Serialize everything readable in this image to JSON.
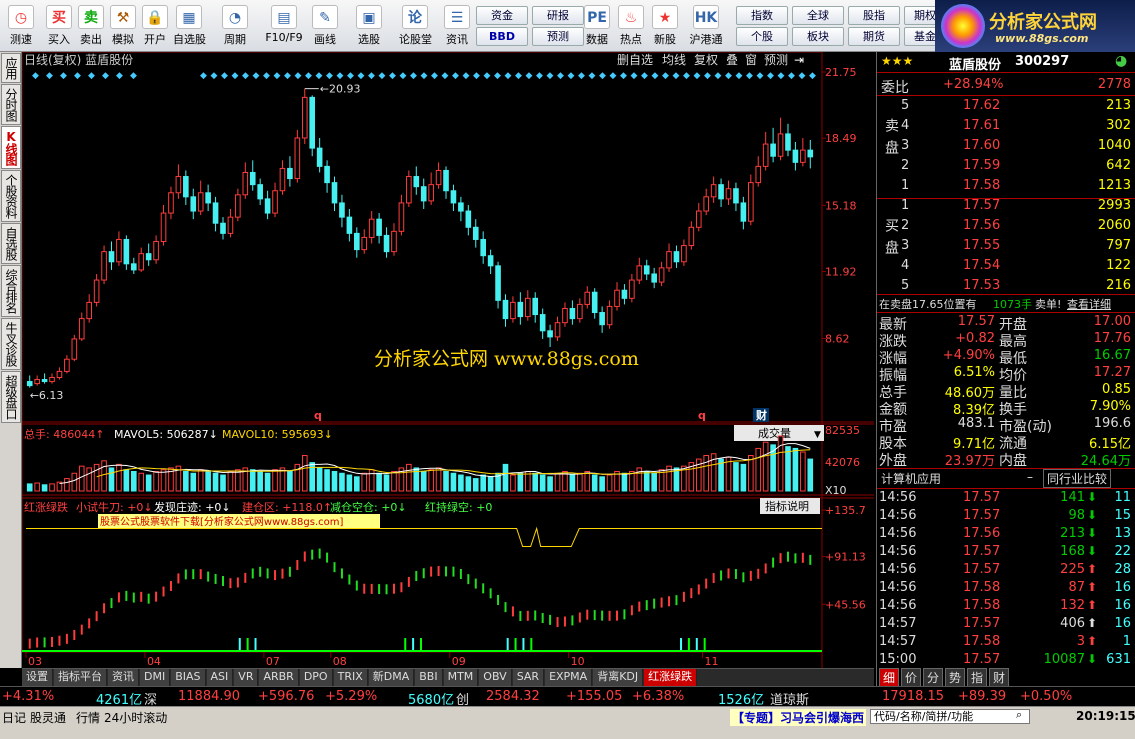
{
  "toolbar": {
    "buttons": [
      {
        "label": "测速",
        "icon": "clock-icon",
        "glyph": "◷",
        "color": "#e33"
      },
      {
        "label": "买入",
        "icon": "buy-icon",
        "glyph": "买",
        "color": "#e33"
      },
      {
        "label": "卖出",
        "icon": "sell-icon",
        "glyph": "卖",
        "color": "#1a1"
      },
      {
        "label": "模拟",
        "icon": "hammer-icon",
        "glyph": "⚒",
        "color": "#a50"
      },
      {
        "label": "开户",
        "icon": "lock-icon",
        "glyph": "🔒",
        "color": "#888"
      },
      {
        "label": "自选股",
        "icon": "grid-icon",
        "glyph": "▦",
        "color": "#36a"
      },
      {
        "label": "周期",
        "icon": "period-icon",
        "glyph": "◔",
        "color": "#36a"
      },
      {
        "label": "F10/F9",
        "icon": "f10-icon",
        "glyph": "▤",
        "color": "#36a"
      },
      {
        "label": "画线",
        "icon": "pencil-icon",
        "glyph": "✎",
        "color": "#36a"
      },
      {
        "label": "选股",
        "icon": "picker-icon",
        "glyph": "▣",
        "color": "#36a"
      },
      {
        "label": "论股堂",
        "icon": "forum-icon",
        "glyph": "论",
        "color": "#36a"
      },
      {
        "label": "资讯",
        "icon": "news-icon",
        "glyph": "☰",
        "color": "#36a"
      },
      {
        "label": "数据",
        "icon": "pe-icon",
        "glyph": "PE",
        "color": "#36a"
      },
      {
        "label": "热点",
        "icon": "hot-icon",
        "glyph": "♨",
        "color": "#e33"
      },
      {
        "label": "新股",
        "icon": "newstock-icon",
        "glyph": "★",
        "color": "#e33"
      },
      {
        "label": "沪港通",
        "icon": "hk-icon",
        "glyph": "HK",
        "color": "#36a"
      }
    ],
    "small_buttons": [
      "资金",
      "研报",
      "BBD",
      "预测",
      "指数",
      "全球",
      "股指",
      "期权",
      "个股",
      "板块",
      "期货",
      "基金"
    ]
  },
  "logo": {
    "title": "分析家公式网",
    "url_text": "www.88gs.com"
  },
  "left_tabs": [
    "应用",
    "分时图",
    "K线图",
    "个股资料",
    "自选股",
    "综合排名",
    "牛叉诊股",
    "超级盘口"
  ],
  "chart": {
    "header_left": "日线(复权)  蓝盾股份",
    "header_buttons": [
      "删自选",
      "均线",
      "复权",
      "叠",
      "窗",
      "预测"
    ],
    "max_label": "20.93",
    "min_label": "6.13",
    "watermark": "分析家公式网 www.88gs.com",
    "price_axis": [
      "21.75",
      "18.49",
      "15.18",
      "11.92",
      "8.62"
    ],
    "event_markers": [
      "q",
      "q",
      "财"
    ],
    "volume_header": {
      "total": "总手: 486044",
      "mavol5": "MAVOL5: 506287",
      "mavol10": "MAVOL10: 595693"
    },
    "volume_selector": "成交量",
    "volume_axis": [
      "82535",
      "42076",
      "X10"
    ],
    "indicator_header": {
      "name": "红涨绿跌",
      "n1": "小试牛刀: +0",
      "n2": "发现庄迹: +0",
      "n3": "建仓区: +118.0",
      "n4": "减仓空仓: +0",
      "n5": "红持绿空: +0"
    },
    "indicator_help": "指标说明",
    "indicator_ad": "股票公式股票软件下载[分析家公式网www.88gs.com]",
    "indicator_axis": [
      "+135.7",
      "+91.13",
      "+45.56"
    ],
    "date_axis": [
      "03",
      "04",
      "07",
      "08",
      "09",
      "10",
      "11"
    ]
  },
  "chart_data": {
    "type": "candlestick",
    "title": "日线(复权) 蓝盾股份",
    "ylim": [
      5.0,
      21.75
    ],
    "x": [
      "03",
      "04",
      "07",
      "08",
      "09",
      "10",
      "11"
    ],
    "max": 20.93,
    "min": 6.13,
    "candles": [
      [
        6.5,
        6.3,
        6.8,
        6.2
      ],
      [
        6.4,
        6.6,
        6.8,
        6.3
      ],
      [
        6.6,
        6.5,
        6.9,
        6.4
      ],
      [
        6.5,
        6.7,
        6.9,
        6.4
      ],
      [
        6.7,
        7.0,
        7.2,
        6.6
      ],
      [
        7.0,
        7.6,
        7.8,
        6.9
      ],
      [
        7.6,
        8.6,
        8.8,
        7.5
      ],
      [
        8.6,
        9.6,
        9.9,
        8.5
      ],
      [
        9.6,
        10.4,
        10.8,
        9.4
      ],
      [
        10.4,
        11.5,
        11.8,
        10.2
      ],
      [
        11.5,
        12.9,
        13.2,
        11.3
      ],
      [
        12.9,
        12.4,
        13.4,
        12.0
      ],
      [
        12.4,
        13.5,
        13.9,
        12.2
      ],
      [
        13.5,
        12.3,
        13.7,
        12.0
      ],
      [
        12.3,
        12.0,
        12.6,
        11.8
      ],
      [
        12.0,
        12.8,
        13.1,
        11.9
      ],
      [
        12.8,
        12.5,
        13.3,
        12.2
      ],
      [
        12.5,
        13.4,
        13.7,
        12.3
      ],
      [
        13.4,
        14.8,
        15.2,
        13.2
      ],
      [
        14.8,
        15.8,
        16.1,
        14.5
      ],
      [
        15.8,
        16.6,
        17.2,
        15.5
      ],
      [
        16.6,
        15.6,
        16.9,
        15.2
      ],
      [
        15.6,
        14.9,
        16.0,
        14.5
      ],
      [
        14.9,
        15.8,
        16.4,
        14.7
      ],
      [
        15.8,
        15.3,
        16.2,
        14.9
      ],
      [
        15.3,
        14.3,
        15.6,
        13.9
      ],
      [
        14.3,
        13.8,
        14.6,
        13.5
      ],
      [
        13.8,
        14.6,
        15.0,
        13.6
      ],
      [
        14.6,
        15.7,
        16.0,
        14.4
      ],
      [
        15.7,
        16.8,
        17.3,
        15.5
      ],
      [
        16.8,
        16.2,
        17.4,
        15.9
      ],
      [
        16.2,
        15.5,
        16.5,
        15.2
      ],
      [
        15.5,
        14.8,
        15.9,
        14.5
      ],
      [
        14.8,
        15.9,
        16.3,
        14.6
      ],
      [
        15.9,
        17.0,
        17.4,
        15.7
      ],
      [
        17.0,
        16.5,
        17.6,
        16.1
      ],
      [
        16.5,
        18.5,
        18.9,
        16.3
      ],
      [
        18.5,
        20.5,
        20.93,
        18.2
      ],
      [
        20.5,
        18.0,
        20.6,
        17.6
      ],
      [
        18.0,
        17.1,
        18.5,
        16.8
      ],
      [
        17.1,
        16.3,
        17.4,
        15.8
      ],
      [
        16.3,
        15.3,
        16.6,
        14.9
      ],
      [
        15.3,
        14.6,
        15.7,
        14.1
      ],
      [
        14.6,
        13.8,
        15.0,
        13.4
      ],
      [
        13.8,
        13.0,
        14.1,
        12.6
      ],
      [
        13.0,
        13.6,
        14.0,
        12.8
      ],
      [
        13.6,
        14.5,
        14.9,
        13.3
      ],
      [
        14.5,
        13.7,
        14.8,
        13.3
      ],
      [
        13.7,
        12.9,
        14.1,
        12.6
      ],
      [
        12.9,
        13.9,
        14.3,
        12.7
      ],
      [
        13.9,
        15.3,
        15.7,
        13.7
      ],
      [
        15.3,
        16.6,
        16.9,
        15.1
      ],
      [
        16.6,
        16.1,
        17.1,
        15.7
      ],
      [
        16.1,
        15.4,
        16.5,
        15.0
      ],
      [
        15.4,
        16.2,
        16.8,
        15.2
      ],
      [
        16.2,
        16.9,
        17.3,
        16.0
      ],
      [
        16.9,
        15.9,
        17.1,
        15.5
      ],
      [
        15.9,
        15.3,
        16.2,
        14.9
      ],
      [
        15.3,
        14.9,
        15.6,
        14.4
      ],
      [
        14.9,
        14.1,
        15.2,
        13.7
      ],
      [
        14.1,
        13.5,
        14.5,
        13.1
      ],
      [
        13.5,
        12.7,
        13.9,
        12.3
      ],
      [
        12.7,
        12.2,
        13.0,
        11.8
      ],
      [
        12.2,
        10.5,
        12.4,
        10.1
      ],
      [
        10.5,
        9.6,
        10.8,
        9.2
      ],
      [
        9.6,
        10.4,
        10.7,
        9.4
      ],
      [
        10.4,
        9.7,
        10.9,
        9.3
      ],
      [
        9.7,
        10.6,
        11.0,
        9.5
      ],
      [
        10.6,
        9.8,
        10.9,
        9.4
      ],
      [
        9.8,
        9.0,
        10.1,
        8.6
      ],
      [
        9.0,
        8.7,
        9.3,
        8.2
      ],
      [
        8.7,
        9.4,
        9.7,
        8.5
      ],
      [
        9.4,
        10.1,
        10.4,
        9.2
      ],
      [
        10.1,
        9.6,
        10.5,
        9.3
      ],
      [
        9.6,
        10.3,
        10.6,
        9.4
      ],
      [
        10.3,
        10.9,
        11.2,
        10.1
      ],
      [
        10.9,
        9.9,
        11.1,
        9.6
      ],
      [
        9.9,
        9.3,
        10.2,
        8.9
      ],
      [
        9.3,
        10.2,
        10.5,
        9.1
      ],
      [
        10.2,
        11.0,
        11.4,
        10.0
      ],
      [
        11.0,
        10.6,
        11.3,
        10.3
      ],
      [
        10.6,
        11.5,
        11.8,
        10.4
      ],
      [
        11.5,
        12.2,
        12.6,
        11.3
      ],
      [
        12.2,
        11.8,
        12.5,
        11.5
      ],
      [
        11.8,
        11.4,
        12.1,
        11.1
      ],
      [
        11.4,
        12.1,
        12.4,
        11.2
      ],
      [
        12.1,
        12.9,
        13.3,
        11.9
      ],
      [
        12.9,
        12.4,
        13.2,
        12.1
      ],
      [
        12.4,
        13.2,
        13.5,
        12.2
      ],
      [
        13.2,
        14.1,
        14.4,
        13.0
      ],
      [
        14.1,
        14.9,
        15.3,
        13.9
      ],
      [
        14.9,
        15.6,
        16.0,
        14.7
      ],
      [
        15.6,
        16.2,
        16.6,
        15.3
      ],
      [
        16.2,
        15.5,
        16.5,
        15.1
      ],
      [
        15.5,
        16.0,
        16.4,
        15.2
      ],
      [
        16.0,
        15.3,
        16.3,
        14.9
      ],
      [
        15.3,
        14.4,
        15.6,
        14.0
      ],
      [
        14.4,
        16.3,
        16.7,
        14.2
      ],
      [
        16.3,
        17.1,
        17.6,
        16.1
      ],
      [
        17.1,
        18.2,
        18.8,
        16.9
      ],
      [
        18.2,
        17.6,
        19.0,
        17.3
      ],
      [
        17.6,
        18.7,
        19.5,
        17.4
      ],
      [
        18.7,
        17.9,
        19.2,
        17.6
      ],
      [
        17.9,
        17.3,
        18.3,
        16.9
      ],
      [
        17.3,
        17.9,
        18.5,
        17.1
      ],
      [
        17.9,
        17.57,
        18.4,
        17.0
      ]
    ],
    "volume": {
      "ylim": [
        0,
        82535
      ],
      "mavol5": 506287,
      "mavol10": 595693,
      "total": 486044,
      "values": [
        8,
        9,
        7,
        8,
        10,
        14,
        20,
        28,
        26,
        30,
        34,
        26,
        30,
        24,
        22,
        20,
        18,
        22,
        24,
        26,
        28,
        22,
        20,
        24,
        22,
        20,
        18,
        22,
        24,
        26,
        24,
        22,
        20,
        24,
        26,
        22,
        30,
        40,
        32,
        26,
        24,
        22,
        20,
        18,
        16,
        20,
        24,
        20,
        18,
        22,
        26,
        30,
        26,
        22,
        24,
        26,
        22,
        20,
        18,
        16,
        14,
        18,
        16,
        20,
        30,
        18,
        20,
        22,
        20,
        18,
        16,
        20,
        22,
        18,
        20,
        22,
        18,
        16,
        18,
        22,
        20,
        22,
        26,
        22,
        20,
        24,
        28,
        26,
        28,
        32,
        36,
        40,
        42,
        36,
        38,
        32,
        30,
        40,
        48,
        55,
        52,
        62,
        50,
        48,
        44,
        36
      ]
    },
    "indicator": {
      "ylim": [
        0,
        135.7
      ],
      "axis": [
        135.7,
        91.13,
        45.56
      ],
      "line_level": 118.0
    }
  },
  "quote": {
    "stars": "★★★",
    "name": "蓝盾股份",
    "code": "300297",
    "weibi_label": "委比",
    "weibi_value": "+28.94%",
    "weibi_diff": "2778",
    "sell_label": "卖盘",
    "buy_label": "买盘",
    "asks": [
      {
        "lvl": "5",
        "price": "17.62",
        "vol": "213"
      },
      {
        "lvl": "4",
        "price": "17.61",
        "vol": "302"
      },
      {
        "lvl": "3",
        "price": "17.60",
        "vol": "1040"
      },
      {
        "lvl": "2",
        "price": "17.59",
        "vol": "642"
      },
      {
        "lvl": "1",
        "price": "17.58",
        "vol": "1213"
      }
    ],
    "bids": [
      {
        "lvl": "1",
        "price": "17.57",
        "vol": "2993"
      },
      {
        "lvl": "2",
        "price": "17.56",
        "vol": "2060"
      },
      {
        "lvl": "3",
        "price": "17.55",
        "vol": "797"
      },
      {
        "lvl": "4",
        "price": "17.54",
        "vol": "122"
      },
      {
        "lvl": "5",
        "price": "17.53",
        "vol": "216"
      }
    ],
    "notice_left": "在卖盘17.65位置有",
    "notice_vol": "1073手",
    "notice_right": "卖单!",
    "notice_link": "查看详细",
    "stats": [
      {
        "l1": "最新",
        "v1": "17.57",
        "l2": "开盘",
        "v2": "17.00",
        "c1": "rd",
        "c2": "rd"
      },
      {
        "l1": "涨跌",
        "v1": "+0.82",
        "l2": "最高",
        "v2": "17.76",
        "c1": "rd",
        "c2": "rd"
      },
      {
        "l1": "涨幅",
        "v1": "+4.90%",
        "l2": "最低",
        "v2": "16.67",
        "c1": "rd",
        "c2": "gn"
      },
      {
        "l1": "振幅",
        "v1": "6.51%",
        "l2": "均价",
        "v2": "17.27",
        "c1": "yl",
        "c2": "rd"
      },
      {
        "l1": "总手",
        "v1": "48.60万",
        "l2": "量比",
        "v2": "0.85",
        "c1": "yl",
        "c2": "yl"
      },
      {
        "l1": "金额",
        "v1": "8.39亿",
        "l2": "换手",
        "v2": "7.90%",
        "c1": "yl",
        "c2": "yl"
      },
      {
        "l1": "市盈",
        "v1": "483.1",
        "l2": "市盈(动)",
        "v2": "196.6",
        "c1": "wh",
        "c2": "wh"
      },
      {
        "l1": "股本",
        "v1": "9.71亿",
        "l2": "流通",
        "v2": "6.15亿",
        "c1": "yl",
        "c2": "yl"
      },
      {
        "l1": "外盘",
        "v1": "23.97万",
        "l2": "内盘",
        "v2": "24.64万",
        "c1": "rd",
        "c2": "gn"
      }
    ],
    "industry": "计算机应用",
    "industry_btn": "同行业比较",
    "ticks": [
      {
        "t": "14:56",
        "p": "17.57",
        "v": "141",
        "d": "down",
        "n": "11",
        "pc": "rd",
        "vc": "gn"
      },
      {
        "t": "14:56",
        "p": "17.57",
        "v": "98",
        "d": "down",
        "n": "15",
        "pc": "rd",
        "vc": "gn"
      },
      {
        "t": "14:56",
        "p": "17.56",
        "v": "213",
        "d": "down",
        "n": "13",
        "pc": "rd",
        "vc": "gn"
      },
      {
        "t": "14:56",
        "p": "17.57",
        "v": "168",
        "d": "down",
        "n": "22",
        "pc": "rd",
        "vc": "gn"
      },
      {
        "t": "14:56",
        "p": "17.57",
        "v": "225",
        "d": "up",
        "n": "28",
        "pc": "rd",
        "vc": "rd"
      },
      {
        "t": "14:56",
        "p": "17.58",
        "v": "87",
        "d": "up",
        "n": "16",
        "pc": "rd",
        "vc": "rd"
      },
      {
        "t": "14:56",
        "p": "17.58",
        "v": "132",
        "d": "up",
        "n": "16",
        "pc": "rd",
        "vc": "rd"
      },
      {
        "t": "14:57",
        "p": "17.57",
        "v": "406",
        "d": "up",
        "n": "16",
        "pc": "rd",
        "vc": "wh"
      },
      {
        "t": "14:57",
        "p": "17.58",
        "v": "3",
        "d": "up",
        "n": "1",
        "pc": "rd",
        "vc": "rd"
      },
      {
        "t": "15:00",
        "p": "17.57",
        "v": "10087",
        "d": "down",
        "n": "631",
        "pc": "rd",
        "vc": "gn"
      }
    ],
    "bottom_tabs": [
      "细",
      "价",
      "分",
      "势",
      "指",
      "财"
    ]
  },
  "bottom_tabs": [
    "设置",
    "指标平台",
    "资讯",
    "DMI",
    "BIAS",
    "ASI",
    "VR",
    "ARBR",
    "DPO",
    "TRIX",
    "新DMA",
    "BBI",
    "MTM",
    "OBV",
    "SAR",
    "EXPMA",
    "背离KDJ",
    "红涨绿跌"
  ],
  "statusbar": [
    {
      "text": "+4.31%",
      "c": "rd"
    },
    {
      "text": "4261亿",
      "c": "cy"
    },
    {
      "text": "深",
      "c": "wh"
    },
    {
      "text": "11884.90",
      "c": "rd"
    },
    {
      "text": "+596.76",
      "c": "rd"
    },
    {
      "text": "+5.29%",
      "c": "rd"
    },
    {
      "text": "5680亿",
      "c": "cy"
    },
    {
      "text": "创",
      "c": "wh"
    },
    {
      "text": "2584.32",
      "c": "rd"
    },
    {
      "text": "+155.05",
      "c": "rd"
    },
    {
      "text": "+6.38%",
      "c": "rd"
    },
    {
      "text": "1526亿",
      "c": "cy"
    },
    {
      "text": "道琼斯",
      "c": "wh"
    },
    {
      "text": "17918.15",
      "c": "rd"
    },
    {
      "text": "+89.39",
      "c": "rd"
    },
    {
      "text": "+0.50%",
      "c": "rd"
    }
  ],
  "footer": {
    "items": [
      "日记",
      "股灵通",
      "行情",
      "24小时滚动"
    ],
    "ticker": "【专题】习马会引爆海西",
    "search_placeholder": "代码/名称/简拼/功能",
    "time": "20:19:15"
  },
  "colors": {
    "up": "#ff3c3c",
    "down": "#46f0f0",
    "ma5": "#ffffff",
    "ma10": "#ffd700",
    "grid": "#8b0000",
    "indicator_line": "#ffd700"
  }
}
